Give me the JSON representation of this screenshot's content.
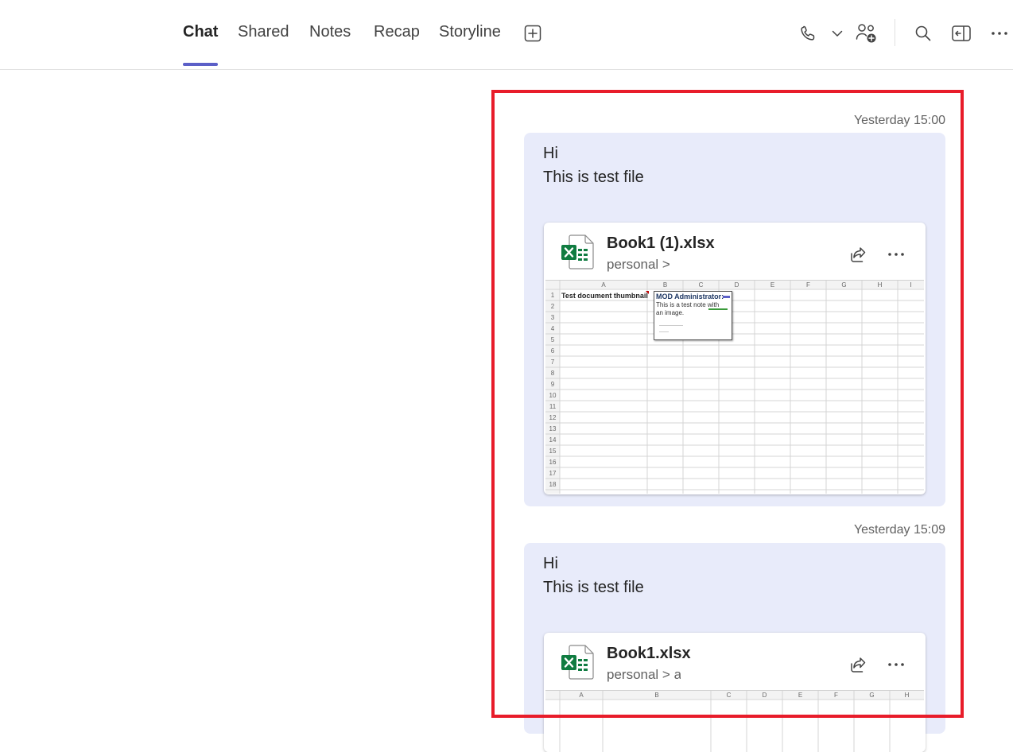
{
  "header": {
    "tabs": [
      {
        "label": "Chat",
        "active": true
      },
      {
        "label": "Shared"
      },
      {
        "label": "Notes"
      },
      {
        "label": "Recap"
      },
      {
        "label": "Storyline"
      }
    ],
    "icons": [
      "add-tab-icon",
      "phone-icon",
      "chevron-down-icon",
      "add-people-icon",
      "search-icon",
      "side-panel-icon",
      "more-icon"
    ],
    "accent_color": "#5b5fc7"
  },
  "highlight_color": "#e81c2a",
  "messages": [
    {
      "timestamp": "Yesterday 15:00",
      "line1": "Hi",
      "line2": "This is test file",
      "file": {
        "name": "Book1 (1).xlsx",
        "path": "personal >"
      }
    },
    {
      "timestamp": "Yesterday 15:09",
      "line1": "Hi",
      "line2": "This is test file",
      "file": {
        "name": "Book1.xlsx",
        "path": "personal > a"
      }
    }
  ],
  "spreadsheet_preview": {
    "columns": [
      "A",
      "B",
      "C",
      "D",
      "E",
      "F",
      "G",
      "H",
      "I"
    ],
    "rows": [
      "1",
      "2",
      "3",
      "4",
      "5",
      "6",
      "7",
      "8",
      "9",
      "10",
      "11",
      "12",
      "13",
      "14",
      "15",
      "16",
      "17",
      "18"
    ],
    "cell_a1": "Test document thumbnail",
    "comment_author": "MOD Administrator:",
    "comment_line1": "This is a test note with",
    "comment_line2": "an image."
  },
  "bubble_color": "#e8ebfa",
  "excel_green": "#107c41"
}
